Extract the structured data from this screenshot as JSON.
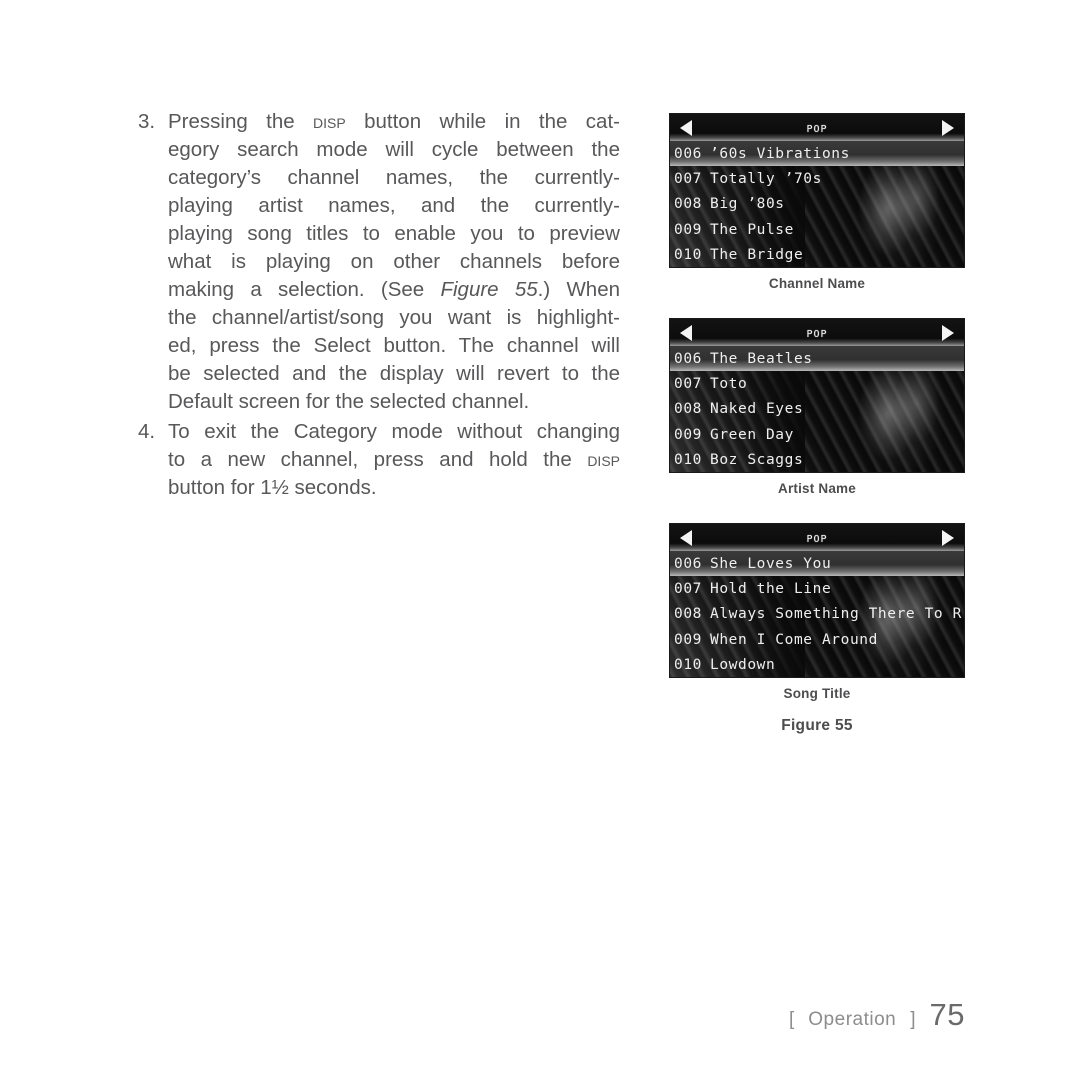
{
  "body": {
    "items": [
      {
        "number": "3.",
        "lines": [
          [
            "Pressing the ",
            {
              "smallcaps": "Disp"
            },
            " button while in the cat-"
          ],
          [
            "egory search mode will cycle between the"
          ],
          [
            "category’s channel names, the currently-"
          ],
          [
            "playing artist names, and the currently-"
          ],
          [
            "playing song titles to enable you to preview"
          ],
          [
            "what is playing on other channels before"
          ],
          [
            "making a selection. (See ",
            {
              "italic": "Figure 55"
            },
            ".) When"
          ],
          [
            "the channel/artist/song you want is highlight-"
          ],
          [
            "ed, press the Select button. The channel will"
          ],
          [
            "be selected and the display will revert to the"
          ],
          [
            "Default screen for the selected channel."
          ]
        ]
      },
      {
        "number": "4.",
        "lines": [
          [
            "To exit the Category mode without changing"
          ],
          [
            "to a new channel, press and hold the ",
            {
              "smallcaps": "Disp"
            }
          ],
          [
            "button for 1½ seconds."
          ]
        ]
      }
    ]
  },
  "figure": {
    "label": "Figure 55",
    "screens": [
      {
        "caption": "Channel Name",
        "title": "Pop",
        "left_arrow": "left-arrow-icon",
        "right_arrow": "right-arrow-icon",
        "rows": [
          {
            "channel": "006",
            "label": "’60s Vibrations",
            "selected": true
          },
          {
            "channel": "007",
            "label": "Totally ’70s",
            "selected": false
          },
          {
            "channel": "008",
            "label": "Big ’80s",
            "selected": false
          },
          {
            "channel": "009",
            "label": "The Pulse",
            "selected": false
          },
          {
            "channel": "010",
            "label": "The Bridge",
            "selected": false
          }
        ]
      },
      {
        "caption": "Artist Name",
        "title": "Pop",
        "left_arrow": "left-arrow-icon",
        "right_arrow": "right-arrow-icon",
        "rows": [
          {
            "channel": "006",
            "label": "The Beatles",
            "selected": true
          },
          {
            "channel": "007",
            "label": "Toto",
            "selected": false
          },
          {
            "channel": "008",
            "label": "Naked Eyes",
            "selected": false
          },
          {
            "channel": "009",
            "label": "Green Day",
            "selected": false
          },
          {
            "channel": "010",
            "label": "Boz Scaggs",
            "selected": false
          }
        ]
      },
      {
        "caption": "Song Title",
        "title": "Pop",
        "left_arrow": "left-arrow-icon",
        "right_arrow": "right-arrow-icon",
        "rows": [
          {
            "channel": "006",
            "label": "She Loves You",
            "selected": true
          },
          {
            "channel": "007",
            "label": "Hold the Line",
            "selected": false
          },
          {
            "channel": "008",
            "label": "Always Something There To R",
            "selected": false
          },
          {
            "channel": "009",
            "label": "When I Come Around",
            "selected": false
          },
          {
            "channel": "010",
            "label": "Lowdown",
            "selected": false
          }
        ]
      }
    ]
  },
  "footer": {
    "bracket_open": "[",
    "section": "Operation",
    "bracket_close": "]",
    "page": "75"
  }
}
